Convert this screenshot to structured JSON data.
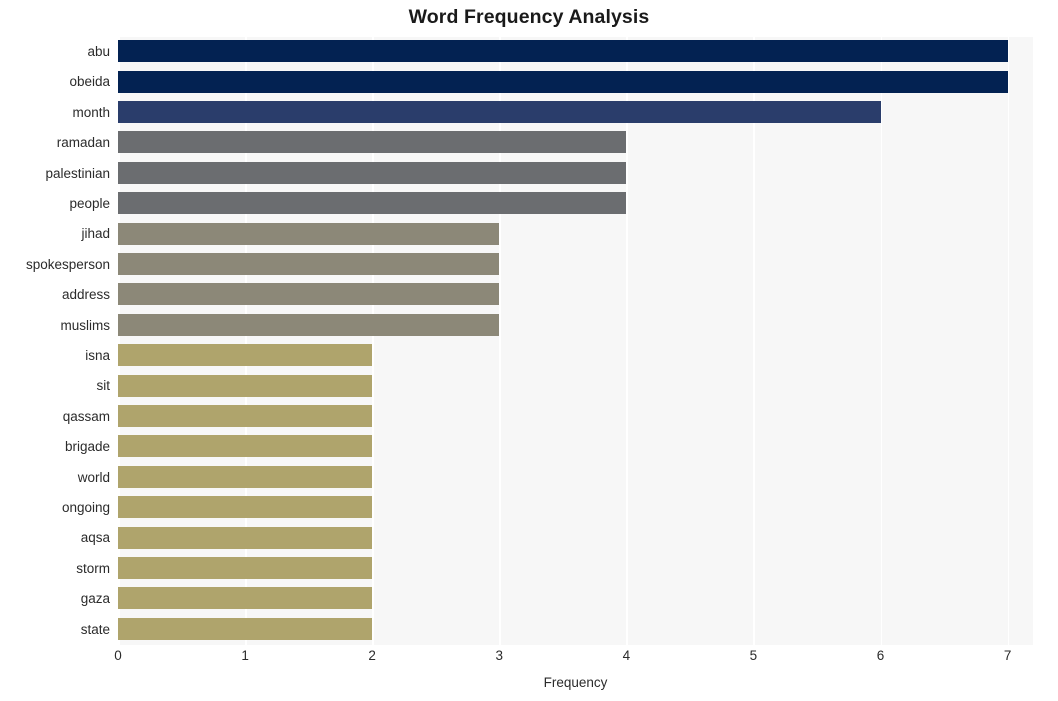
{
  "chart_data": {
    "type": "bar",
    "orientation": "horizontal",
    "title": "Word Frequency Analysis",
    "xlabel": "Frequency",
    "ylabel": "",
    "xlim": [
      0,
      7.2
    ],
    "xticks": [
      0,
      1,
      2,
      3,
      4,
      5,
      6,
      7
    ],
    "xtick_labels": [
      "0",
      "1",
      "2",
      "3",
      "4",
      "5",
      "6",
      "7"
    ],
    "grid": "vertical-white",
    "legend": "none",
    "categories": [
      "abu",
      "obeida",
      "month",
      "ramadan",
      "palestinian",
      "people",
      "jihad",
      "spokesperson",
      "address",
      "muslims",
      "isna",
      "sit",
      "qassam",
      "brigade",
      "world",
      "ongoing",
      "aqsa",
      "storm",
      "gaza",
      "state"
    ],
    "values": [
      7,
      7,
      6,
      4,
      4,
      4,
      3,
      3,
      3,
      3,
      2,
      2,
      2,
      2,
      2,
      2,
      2,
      2,
      2,
      2
    ],
    "bar_colors": [
      "#032252",
      "#032252",
      "#2a3d6b",
      "#6b6d70",
      "#6b6d70",
      "#6b6d70",
      "#8c8878",
      "#8c8878",
      "#8c8878",
      "#8c8878",
      "#afa46c",
      "#afa46c",
      "#afa46c",
      "#afa46c",
      "#afa46c",
      "#afa46c",
      "#afa46c",
      "#afa46c",
      "#afa46c",
      "#afa46c"
    ],
    "plot_background": "#f7f7f7",
    "figure_background": "#ffffff",
    "text_color": "#2b2b2b",
    "title_color": "#1a1a1a"
  }
}
